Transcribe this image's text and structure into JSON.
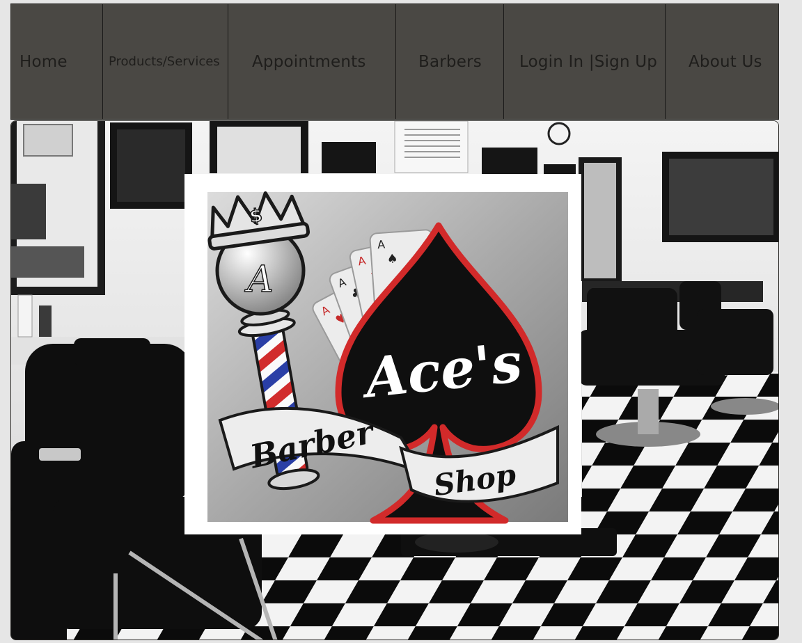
{
  "nav": {
    "items": [
      {
        "label": "Home"
      },
      {
        "label": "Products/Services"
      },
      {
        "label": "Appointments"
      },
      {
        "label": "Barbers"
      },
      {
        "label": "Login In |Sign Up"
      },
      {
        "label": "About Us"
      }
    ]
  },
  "logo": {
    "name": "Ace's",
    "line1": "Barber",
    "line2": "Shop",
    "crown_mark": "$",
    "globe_mark": "A",
    "card_mark": "A"
  },
  "colors": {
    "nav_bg": "#4a4844",
    "nav_text": "#1f1e1c",
    "pole_red": "#d12c2c",
    "pole_blue": "#2a3fa6",
    "spade_outline": "#d22a2a"
  }
}
